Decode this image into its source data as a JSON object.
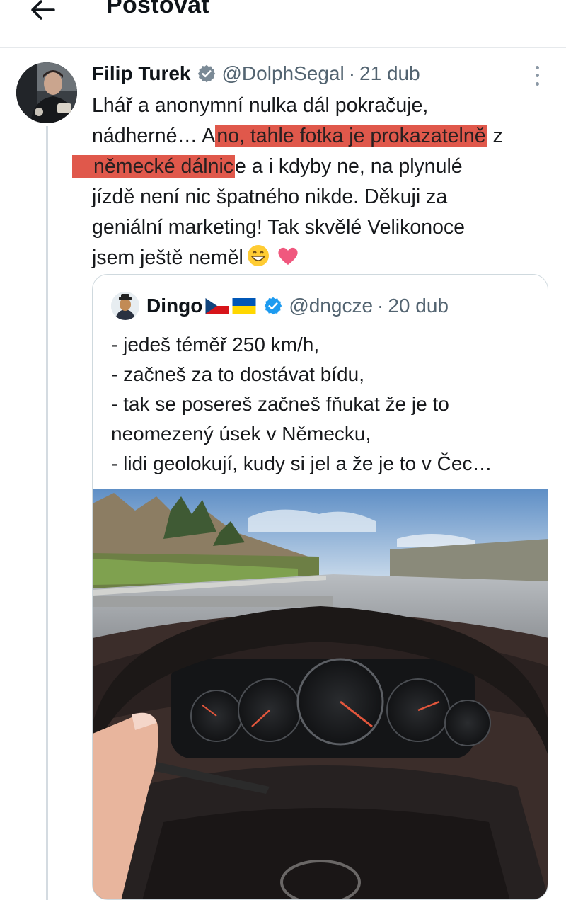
{
  "header": {
    "title": "Postovat",
    "back_icon": "arrow-left-icon"
  },
  "tweet": {
    "author_name": "Filip Turek",
    "verified_icon": "verified-badge-icon",
    "handle": "@DolphSegal",
    "separator": "·",
    "date": "21 dub",
    "more_icon": "more-vertical-icon",
    "text_lines": [
      {
        "parts": [
          {
            "text": "Lhář a anonymní nulka dál pokračuje,",
            "highlight": false
          }
        ]
      },
      {
        "parts": [
          {
            "text": "nádherné… A",
            "highlight": false
          },
          {
            "text": "no, tahle fotka je prokazatelně",
            "highlight": true
          },
          {
            "text": " z",
            "highlight": false
          }
        ]
      },
      {
        "parts": [
          {
            "text": "německé dálnic",
            "highlight": true
          },
          {
            "text": "e a i kdyby ne, na plynulé",
            "highlight": false
          }
        ]
      },
      {
        "parts": [
          {
            "text": "jízdě není nic špatného nikde. Děkuji za",
            "highlight": false
          }
        ]
      },
      {
        "parts": [
          {
            "text": "geniální marketing! Tak skvělé Velikonoce",
            "highlight": false
          }
        ]
      },
      {
        "parts": [
          {
            "text": "jsem ještě neměl",
            "highlight": false
          }
        ]
      }
    ],
    "emojis": [
      "grinning-face-emoji",
      "pink-heart-emoji"
    ],
    "highlight_color": "#e0584b"
  },
  "quote": {
    "author_name": "Dingo",
    "flags": [
      "czech-flag-icon",
      "ukraine-flag-icon"
    ],
    "verified_icon": "verified-badge-icon",
    "handle": "@dngcze",
    "separator": "·",
    "date": "20 dub",
    "lines": [
      "- jedeš téměř 250 km/h,",
      "- začneš za to dostávat bídu,",
      "- tak se posereš začneš fňukat že je to",
      "neomezený úsek v Německu,",
      "- lidi geolokují, kudy si jel a že je to v Čec…"
    ],
    "media_alt_icon": "dashboard-photo"
  },
  "colors": {
    "verified": "#1d9bf0",
    "muted": "#536471",
    "border": "#cfd9de"
  }
}
